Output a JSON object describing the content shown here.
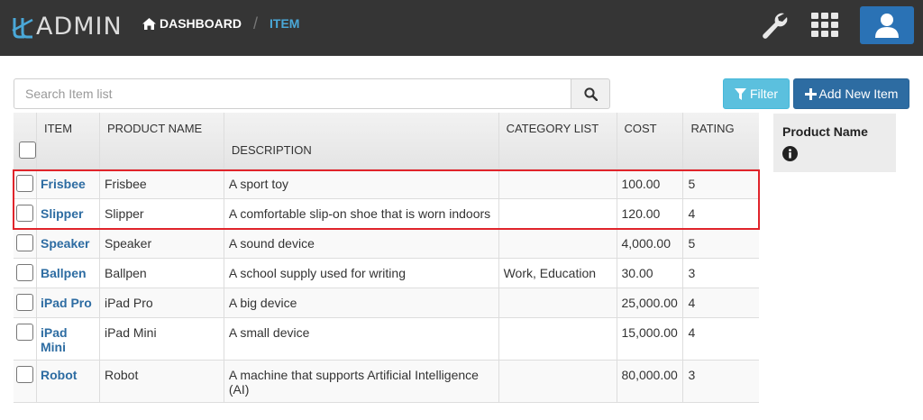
{
  "app": {
    "logo_text": "ADMIN"
  },
  "breadcrumb": {
    "home_label": "DASHBOARD",
    "current_label": "ITEM"
  },
  "search": {
    "placeholder": "Search Item list"
  },
  "buttons": {
    "filter_label": "Filter",
    "add_label": "Add New Item"
  },
  "table": {
    "headers": {
      "item": "ITEM",
      "product_name": "PRODUCT NAME",
      "description": "DESCRIPTION",
      "category": "CATEGORY LIST",
      "cost": "COST",
      "rating": "RATING"
    },
    "rows": [
      {
        "item": "Frisbee",
        "product_name": "Frisbee",
        "description": "A sport toy",
        "category": "",
        "cost": "100.00",
        "rating": "5"
      },
      {
        "item": "Slipper",
        "product_name": "Slipper",
        "description": "A comfortable slip-on shoe that is worn indoors",
        "category": "",
        "cost": "120.00",
        "rating": "4"
      },
      {
        "item": "Speaker",
        "product_name": "Speaker",
        "description": "A sound device",
        "category": "",
        "cost": "4,000.00",
        "rating": "5"
      },
      {
        "item": "Ballpen",
        "product_name": "Ballpen",
        "description": "A school supply used for writing",
        "category": "Work, Education",
        "cost": "30.00",
        "rating": "3"
      },
      {
        "item": "iPad Pro",
        "product_name": "iPad Pro",
        "description": "A big device",
        "category": "",
        "cost": "25,000.00",
        "rating": "4"
      },
      {
        "item": "iPad Mini",
        "product_name": "iPad Mini",
        "description": "A small device",
        "category": "",
        "cost": "15,000.00",
        "rating": "4"
      },
      {
        "item": "Robot",
        "product_name": "Robot",
        "description": "A machine that supports Artificial Intelligence (AI)",
        "category": "",
        "cost": "80,000.00",
        "rating": "3"
      }
    ]
  },
  "side_panel": {
    "title": "Product Name"
  },
  "colors": {
    "topbar": "#353535",
    "accent": "#4aa8d8",
    "primary": "#2d6ca2",
    "info": "#5bc0de",
    "highlight": "#e0242b"
  },
  "icons": [
    "logo-icon",
    "home-icon",
    "wrench-icon",
    "grid-icon",
    "user-icon",
    "search-icon",
    "filter-icon",
    "plus-icon",
    "info-icon"
  ]
}
